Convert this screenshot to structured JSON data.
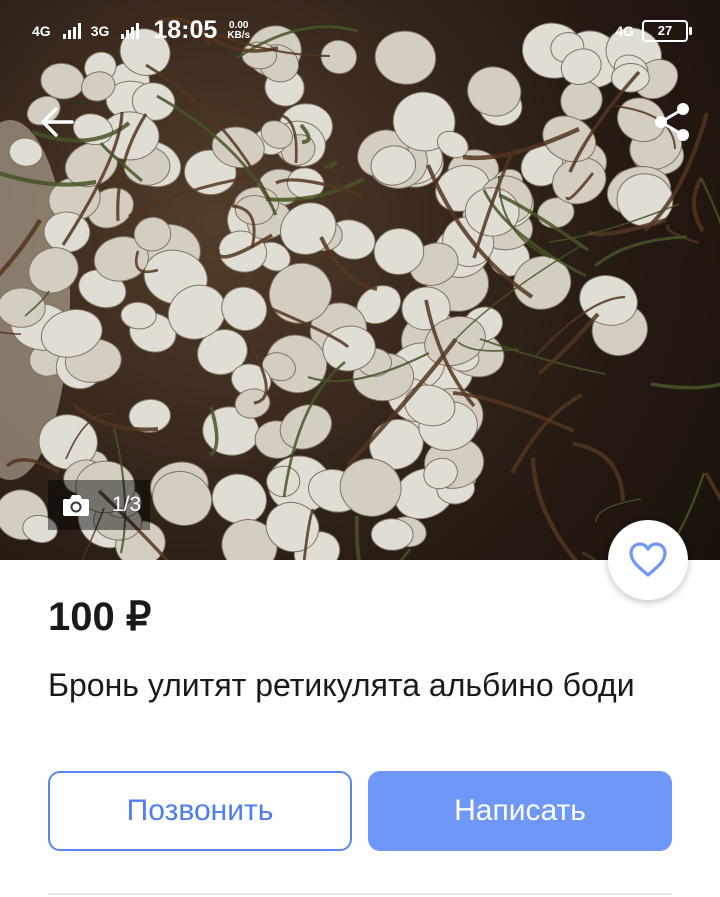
{
  "status_bar": {
    "network_1": "4G",
    "network_2": "3G",
    "time": "18:05",
    "speed_value": "0.00",
    "speed_unit": "KB/s",
    "network_right": "4G",
    "battery": "27"
  },
  "photo": {
    "counter": "1/3",
    "description_icon": "camera-icon"
  },
  "icons": {
    "back": "arrow-left-icon",
    "share": "share-icon",
    "favorite": "heart-outline-icon"
  },
  "listing": {
    "price": "100 ₽",
    "title": "Бронь улитят ретикулята альбино боди"
  },
  "actions": {
    "call_label": "Позвонить",
    "write_label": "Написать"
  },
  "colors": {
    "accent": "#6f97f8",
    "accent_text": "#4d7cf4"
  }
}
